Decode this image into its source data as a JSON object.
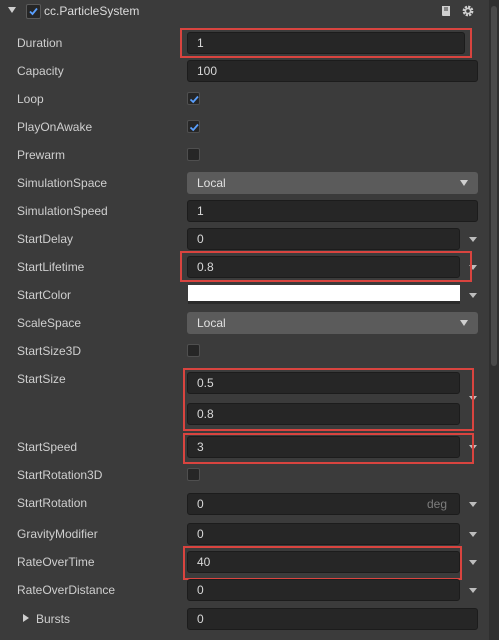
{
  "component": {
    "title": "cc.ParticleSystem",
    "enabled": true,
    "icons": [
      "collapse-arrow-icon",
      "book-icon",
      "gear-icon"
    ]
  },
  "props": {
    "duration": {
      "label": "Duration",
      "value": "1"
    },
    "capacity": {
      "label": "Capacity",
      "value": "100"
    },
    "loop": {
      "label": "Loop",
      "checked": true
    },
    "playOnAwake": {
      "label": "PlayOnAwake",
      "checked": true
    },
    "prewarm": {
      "label": "Prewarm",
      "checked": false
    },
    "simulationSpace": {
      "label": "SimulationSpace",
      "value": "Local"
    },
    "simulationSpeed": {
      "label": "SimulationSpeed",
      "value": "1"
    },
    "startDelay": {
      "label": "StartDelay",
      "value": "0"
    },
    "startLifetime": {
      "label": "StartLifetime",
      "value": "0.8"
    },
    "startColor": {
      "label": "StartColor",
      "color": "#ffffff"
    },
    "scaleSpace": {
      "label": "ScaleSpace",
      "value": "Local"
    },
    "startSize3D": {
      "label": "StartSize3D",
      "checked": false
    },
    "startSize": {
      "label": "StartSize",
      "min": "0.5",
      "max": "0.8"
    },
    "startSpeed": {
      "label": "StartSpeed",
      "value": "3"
    },
    "startRotation3D": {
      "label": "StartRotation3D",
      "checked": false
    },
    "startRotation": {
      "label": "StartRotation",
      "value": "0",
      "unit": "deg"
    },
    "gravityModifier": {
      "label": "GravityModifier",
      "value": "0"
    },
    "rateOverTime": {
      "label": "RateOverTime",
      "value": "40"
    },
    "rateOverDistance": {
      "label": "RateOverDistance",
      "value": "0"
    },
    "bursts": {
      "label": "Bursts",
      "value": "0"
    }
  },
  "colors": {
    "highlight": "#d9443f",
    "accent": "#4a90e2"
  }
}
